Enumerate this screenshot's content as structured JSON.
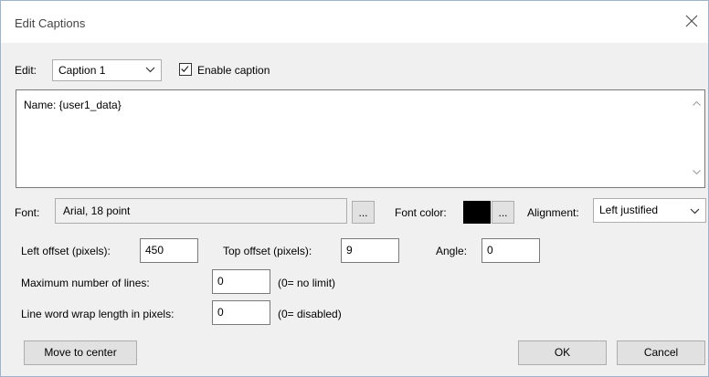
{
  "window": {
    "title": "Edit Captions"
  },
  "edit": {
    "label": "Edit:",
    "selected": "Caption 1",
    "enable_label": "Enable caption",
    "enabled": true
  },
  "caption_text": "Name: {user1_data}",
  "font": {
    "label": "Font:",
    "value": "Arial, 18 point",
    "browse": "..."
  },
  "font_color": {
    "label": "Font color:",
    "color": "#000000",
    "browse": "..."
  },
  "alignment": {
    "label": "Alignment:",
    "selected": "Left justified"
  },
  "left_offset": {
    "label": "Left offset (pixels):",
    "value": "450"
  },
  "top_offset": {
    "label": "Top offset (pixels):",
    "value": "9"
  },
  "angle": {
    "label": "Angle:",
    "value": "0"
  },
  "max_lines": {
    "label": "Maximum number of lines:",
    "value": "0",
    "note": "(0= no limit)"
  },
  "wrap_length": {
    "label": "Line word wrap length in pixels:",
    "value": "0",
    "note": "(0= disabled)"
  },
  "buttons": {
    "move_center": "Move to center",
    "ok": "OK",
    "cancel": "Cancel"
  },
  "icons": {
    "close": "close-icon",
    "chevron": "chevron-down-icon",
    "check": "checkmark-icon",
    "scroll_up": "scroll-up-icon",
    "scroll_down": "scroll-down-icon"
  }
}
